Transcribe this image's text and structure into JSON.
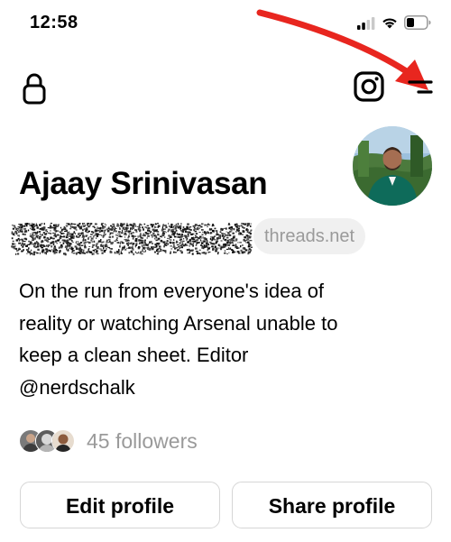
{
  "status_bar": {
    "time": "12:58",
    "icons": [
      "signal-icon",
      "wifi-icon",
      "battery-icon"
    ]
  },
  "header": {
    "left_icon": "lock-icon",
    "right_icons": [
      "instagram-icon",
      "menu-icon"
    ]
  },
  "annotation": {
    "type": "red-arrow",
    "points_to": "menu-icon",
    "color": "#e8261f"
  },
  "profile": {
    "name": "Ajaay Srinivasan",
    "username_redacted": true,
    "domain_badge": "threads.net",
    "bio_lines": [
      "On the run from everyone's idea of",
      "reality or watching Arsenal unable to",
      "keep a clean sheet. Editor",
      "@nerdschalk"
    ],
    "followers_text": "45 followers"
  },
  "actions": {
    "edit_label": "Edit profile",
    "share_label": "Share profile"
  },
  "colors": {
    "text": "#000000",
    "muted": "#9a9a9a",
    "badge_bg": "#f0f0f0",
    "button_border": "#d6d6d6",
    "arrow": "#e8261f"
  }
}
